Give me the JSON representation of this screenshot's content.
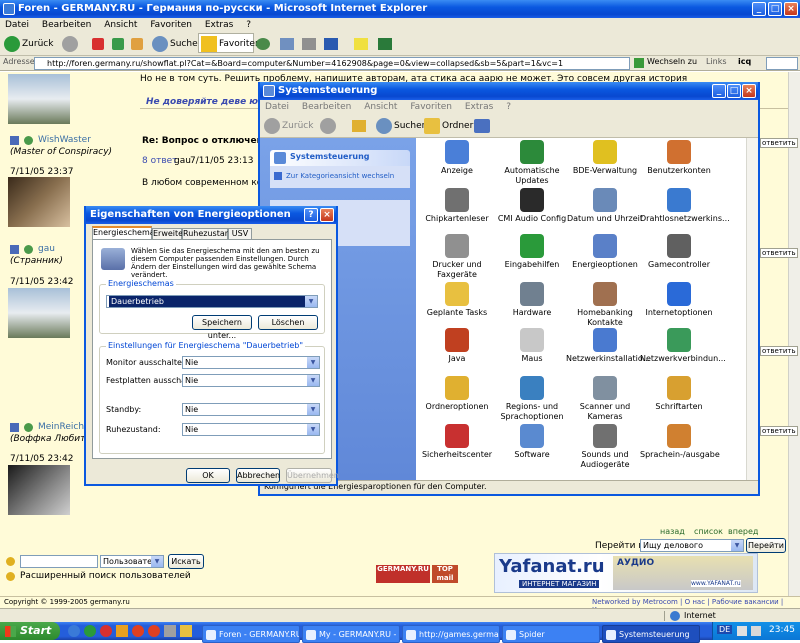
{
  "browser": {
    "title": "Foren - GERMANY.RU - Германия по-русски - Microsoft Internet Explorer",
    "menu": [
      "Datei",
      "Bearbeiten",
      "Ansicht",
      "Favoriten",
      "Extras",
      "?"
    ],
    "toolbar": {
      "back": "Zurück",
      "search": "Suchen",
      "favorites": "Favoriten"
    },
    "address_label": "Adresse",
    "address_url": "http://foren.germany.ru/showflat.pl?Cat=&Board=computer&Number=4162908&page=0&view=collapsed&sb=5&part=1&vc=1",
    "go_label": "Wechseln zu",
    "links_label": "Links",
    "icq_label": "icq"
  },
  "forum": {
    "top_text": "Но не в том суть. Решить проблему, напишите авторам, ата стика аса аарю не может. Это совсем другая история",
    "warning_text": "Не доверяйте деве юной крепкой",
    "posts": [
      {
        "username": "WishWaster",
        "title": "(Master of Conspiracy)",
        "time": "7/11/05 23:37",
        "subject": "Re: Вопрос о отключении ко",
        "reply_prefix": "8 ответ",
        "reply_author": "gau",
        "reply_time": "7/11/05 23:13",
        "body": "В любом современном компе ес"
      },
      {
        "username": "gau",
        "title": "(Странник)",
        "time": "7/11/05 23:42"
      },
      {
        "username": "MeinReich",
        "title": "(Воффка Любитель",
        "time": "7/11/05 23:42"
      }
    ],
    "side_buttons": [
      "ответить",
      "ответить",
      "ответить",
      "ответить"
    ],
    "nav": [
      "назад",
      "список",
      "вперед"
    ],
    "goto_label": "Перейти на",
    "goto_select": "Ищу делового партнера",
    "goto_button": "Перейти",
    "user_select": "Пользователя",
    "search_button": "Искать",
    "adv_search": "Расширенный поиск пользователей",
    "copyright": "Copyright © 1999-2005 germany.ru",
    "network": "Networked by Metrocom | О нас | Рабочие вакансии | Контакт",
    "internet_zone": "Internet"
  },
  "ads": {
    "germany_badge": "GERMANY.RU",
    "top_mail_top": "TOP",
    "top_mail_bottom": "mail",
    "yafanat": "Yafanat.ru",
    "yafanat_sub": "ИНТЕРНЕТ МАГАЗИН",
    "audio": "АУДИО",
    "yafanat_url": "www.YAFANAT.ru"
  },
  "control_panel": {
    "title": "Systemsteuerung",
    "menu": [
      "Datei",
      "Bearbeiten",
      "Ansicht",
      "Favoriten",
      "Extras",
      "?"
    ],
    "toolbar": {
      "back": "Zurück",
      "search": "Suchen",
      "folders": "Ordner"
    },
    "sidebar_title": "Systemsteuerung",
    "sidebar_link": "Zur Kategorieansicht wechseln",
    "status": "Konfiguriert die Energiesparoptionen für den Computer.",
    "items": [
      {
        "label": "Anzeige",
        "color": "#4a7fd8"
      },
      {
        "label": "Automatische Updates",
        "color": "#2c8a3a"
      },
      {
        "label": "BDE-Verwaltung",
        "color": "#e0c020"
      },
      {
        "label": "Benutzerkonten",
        "color": "#d07030"
      },
      {
        "label": "Chipkartenleser",
        "color": "#707070"
      },
      {
        "label": "CMI Audio Config",
        "color": "#2a2a2a"
      },
      {
        "label": "Datum und Uhrzeit",
        "color": "#6a8ab8"
      },
      {
        "label": "Drahtlosnetzwerkins...",
        "color": "#3a7ad0"
      },
      {
        "label": "Drucker und Faxgeräte",
        "color": "#909090"
      },
      {
        "label": "Eingabehilfen",
        "color": "#2a9a3a"
      },
      {
        "label": "Energieoptionen",
        "color": "#5a80c8"
      },
      {
        "label": "Gamecontroller",
        "color": "#606060"
      },
      {
        "label": "Geplante Tasks",
        "color": "#e8c040"
      },
      {
        "label": "Hardware",
        "color": "#708090"
      },
      {
        "label": "Homebanking Kontakte",
        "color": "#a07050"
      },
      {
        "label": "Internetoptionen",
        "color": "#2a6ad8"
      },
      {
        "label": "Java",
        "color": "#c04020"
      },
      {
        "label": "Maus",
        "color": "#c8c8c8"
      },
      {
        "label": "Netzwerkinstallatio...",
        "color": "#4a7ad0"
      },
      {
        "label": "Netzwerkverbindun...",
        "color": "#3a9a5a"
      },
      {
        "label": "Ordneroptionen",
        "color": "#e0b030"
      },
      {
        "label": "Regions- und Sprachoptionen",
        "color": "#3a80c0"
      },
      {
        "label": "Scanner und Kameras",
        "color": "#8090a0"
      },
      {
        "label": "Schriftarten",
        "color": "#d8a030"
      },
      {
        "label": "Sicherheitscenter",
        "color": "#c83030"
      },
      {
        "label": "Software",
        "color": "#5a8ad0"
      },
      {
        "label": "Sounds und Audiogeräte",
        "color": "#707070"
      },
      {
        "label": "Sprachein-/ausgabe",
        "color": "#d08030"
      }
    ]
  },
  "dialog": {
    "title": "Eigenschaften von Energieoptionen",
    "tabs": [
      "Energieschemas",
      "Erweitert",
      "Ruhezustand",
      "USV"
    ],
    "description": "Wählen Sie das Energieschema mit den am besten zu diesem Computer passenden Einstellungen. Durch Ändern der Einstellungen wird das gewählte Schema verändert.",
    "schemes_legend": "Energieschemas",
    "scheme_value": "Dauerbetrieb",
    "save_as": "Speichern unter...",
    "delete": "Löschen",
    "settings_legend": "Einstellungen für Energieschema \"Dauerbetrieb\"",
    "monitor_label": "Monitor ausschalten:",
    "monitor_value": "Nie",
    "disk_label": "Festplatten ausschalten:",
    "disk_value": "Nie",
    "standby_label": "Standby:",
    "standby_value": "Nie",
    "hibernate_label": "Ruhezustand:",
    "hibernate_value": "Nie",
    "ok": "OK",
    "cancel": "Abbrechen",
    "apply": "Übernehmen"
  },
  "taskbar": {
    "start": "Start",
    "tasks": [
      "Foren - GERMANY.RU...",
      "My - GERMANY.RU - ...",
      "http://games.german...",
      "Spider",
      "Systemsteuerung"
    ],
    "lang": "DE",
    "clock": "23:45"
  }
}
